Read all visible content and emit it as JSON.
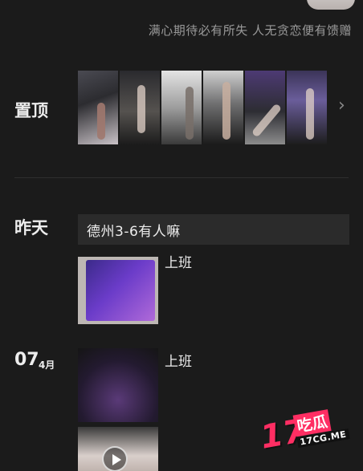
{
  "profile": {
    "signature": "满心期待必有所失 人无贪恋便有馈赠"
  },
  "sections": {
    "pinned_label": "置顶",
    "yesterday_label": "昨天"
  },
  "yesterday": {
    "text_post": "德州3-6有人嘛",
    "media_post_caption": "上班"
  },
  "date_group": {
    "day": "07",
    "month": "4月",
    "caption": "上班"
  },
  "icons": {
    "more": "chevron-right-icon",
    "video": "play-icon"
  },
  "watermark": {
    "number": "17",
    "chars": "吃瓜",
    "domain": "17CG.ME"
  },
  "colors": {
    "background": "#1b1b1b",
    "accent": "#ff2e63"
  }
}
